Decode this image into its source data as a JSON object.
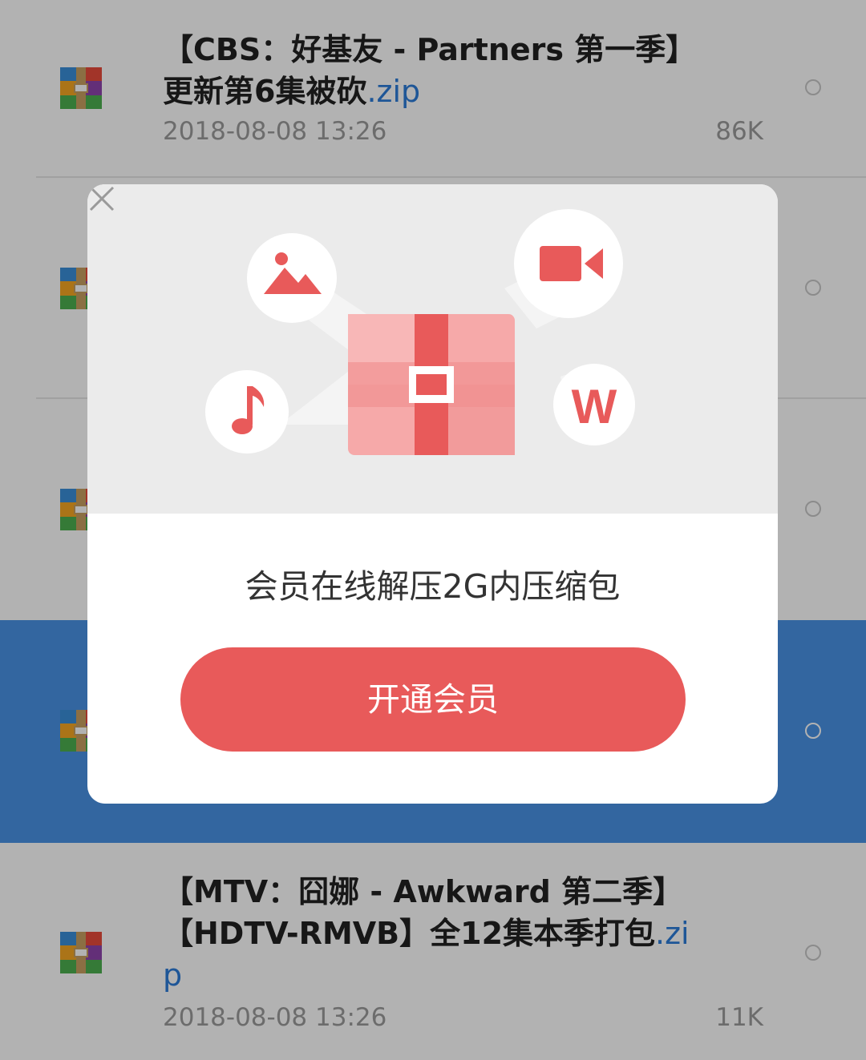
{
  "files": [
    {
      "name": "【CBS：好基友 - Partners 第一季】更新第6集被砍",
      "ext": ".zip",
      "date": "2018-08-08 13:26",
      "size": "86K",
      "selected": false
    },
    {
      "name": "",
      "ext": "",
      "date": "",
      "size": "",
      "selected": false
    },
    {
      "name": "",
      "ext": "",
      "date": "",
      "size": "",
      "selected": false
    },
    {
      "name": "",
      "ext": "",
      "date": "",
      "size": "",
      "selected": true
    },
    {
      "name": "【MTV：囧娜 - Awkward 第二季】【HDTV-RMVB】全12集本季打包",
      "ext": ".zip",
      "date": "2018-08-08 13:26",
      "size": "11K",
      "selected": false
    }
  ],
  "dialog": {
    "message": "会员在线解压2G内压缩包",
    "cta_label": "开通会员",
    "icons": [
      "image-icon",
      "video-camera-icon",
      "music-note-icon",
      "word-document-icon",
      "archive-box-icon",
      "close-icon"
    ]
  },
  "colors": {
    "accent_red": "#e85a5a",
    "selected_row": "#4a93e6",
    "link_blue": "#2b7bd8"
  }
}
